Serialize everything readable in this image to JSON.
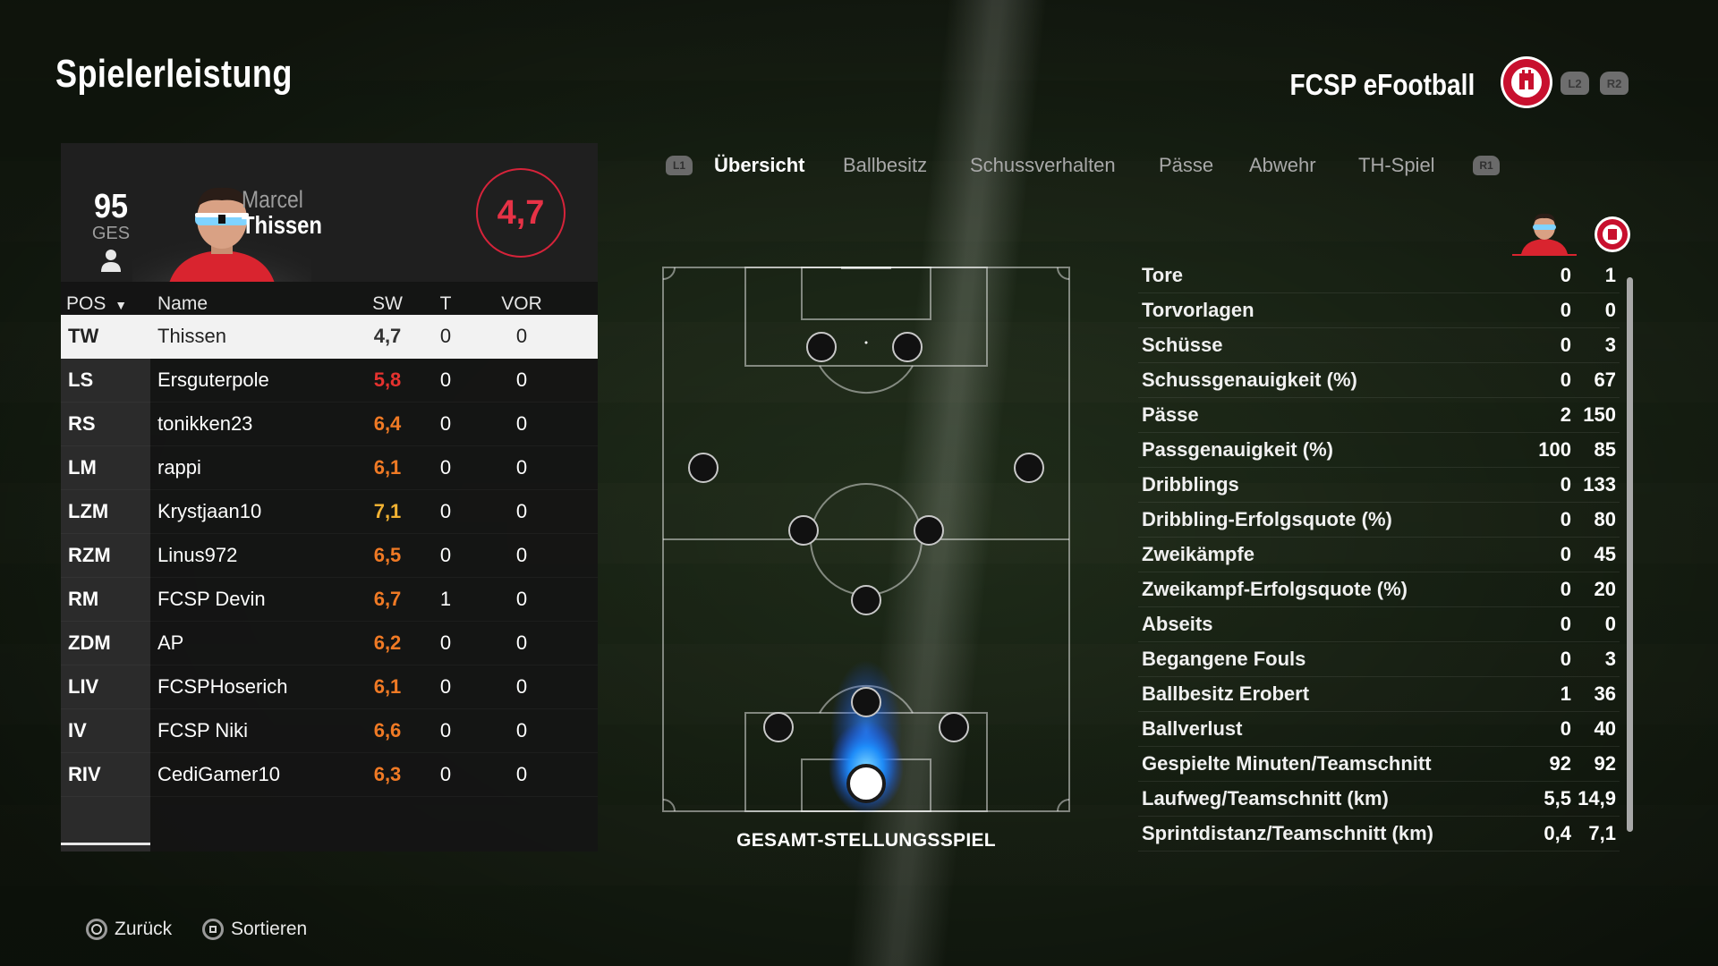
{
  "header": {
    "title": "Spielerleistung",
    "team_name": "FCSP eFootball",
    "left_trigger": "L2",
    "right_trigger": "R2"
  },
  "player_card": {
    "overall_value": "95",
    "overall_label": "GES",
    "first_name": "Marcel",
    "last_name": "Thissen",
    "match_rating": "4,7"
  },
  "table": {
    "headers": {
      "pos": "POS",
      "name": "Name",
      "sw": "SW",
      "t": "T",
      "vor": "VOR"
    },
    "rows": [
      {
        "pos": "TW",
        "name": "Thissen",
        "sw": "4,7",
        "t": "0",
        "vor": "0",
        "sw_color": "#333333"
      },
      {
        "pos": "LS",
        "name": "Ersguterpole",
        "sw": "5,8",
        "t": "0",
        "vor": "0",
        "sw_color": "#e5322f"
      },
      {
        "pos": "RS",
        "name": "tonikken23",
        "sw": "6,4",
        "t": "0",
        "vor": "0",
        "sw_color": "#f07a25"
      },
      {
        "pos": "LM",
        "name": "rappi",
        "sw": "6,1",
        "t": "0",
        "vor": "0",
        "sw_color": "#f07a25"
      },
      {
        "pos": "LZM",
        "name": "Krystjaan10",
        "sw": "7,1",
        "t": "0",
        "vor": "0",
        "sw_color": "#f2b233"
      },
      {
        "pos": "RZM",
        "name": "Linus972",
        "sw": "6,5",
        "t": "0",
        "vor": "0",
        "sw_color": "#f07a25"
      },
      {
        "pos": "RM",
        "name": "FCSP Devin",
        "sw": "6,7",
        "t": "1",
        "vor": "0",
        "sw_color": "#f07a25"
      },
      {
        "pos": "ZDM",
        "name": "AP",
        "sw": "6,2",
        "t": "0",
        "vor": "0",
        "sw_color": "#f07a25"
      },
      {
        "pos": "LIV",
        "name": "FCSPHoserich",
        "sw": "6,1",
        "t": "0",
        "vor": "0",
        "sw_color": "#f07a25"
      },
      {
        "pos": "IV",
        "name": "FCSP Niki",
        "sw": "6,6",
        "t": "0",
        "vor": "0",
        "sw_color": "#f07a25"
      },
      {
        "pos": "RIV",
        "name": "CediGamer10",
        "sw": "6,3",
        "t": "0",
        "vor": "0",
        "sw_color": "#f07a25"
      }
    ]
  },
  "tabs": {
    "left_button": "L1",
    "right_button": "R1",
    "items": [
      "Übersicht",
      "Ballbesitz",
      "Schussverhalten",
      "Pässe",
      "Abwehr",
      "TH-Spiel"
    ],
    "active_index": 0
  },
  "pitch": {
    "caption": "GESAMT-STELLUNGSSPIEL"
  },
  "stats": [
    {
      "label": "Tore",
      "player": "0",
      "team": "1"
    },
    {
      "label": "Torvorlagen",
      "player": "0",
      "team": "0"
    },
    {
      "label": "Schüsse",
      "player": "0",
      "team": "3"
    },
    {
      "label": "Schussgenauigkeit (%)",
      "player": "0",
      "team": "67"
    },
    {
      "label": "Pässe",
      "player": "2",
      "team": "150"
    },
    {
      "label": "Passgenauigkeit (%)",
      "player": "100",
      "team": "85"
    },
    {
      "label": "Dribblings",
      "player": "0",
      "team": "133"
    },
    {
      "label": "Dribbling-Erfolgsquote (%)",
      "player": "0",
      "team": "80"
    },
    {
      "label": "Zweikämpfe",
      "player": "0",
      "team": "45"
    },
    {
      "label": "Zweikampf-Erfolgsquote (%)",
      "player": "0",
      "team": "20"
    },
    {
      "label": "Abseits",
      "player": "0",
      "team": "0"
    },
    {
      "label": "Begangene Fouls",
      "player": "0",
      "team": "3"
    },
    {
      "label": "Ballbesitz Erobert",
      "player": "1",
      "team": "36"
    },
    {
      "label": "Ballverlust",
      "player": "0",
      "team": "40"
    },
    {
      "label": "Gespielte Minuten/Teamschnitt",
      "player": "92",
      "team": "92"
    },
    {
      "label": "Laufweg/Teamschnitt (km)",
      "player": "5,5",
      "team": "14,9"
    },
    {
      "label": "Sprintdistanz/Teamschnitt (km)",
      "player": "0,4",
      "team": "7,1"
    }
  ],
  "footer": {
    "back_label": "Zurück",
    "sort_label": "Sortieren"
  },
  "colors": {
    "accent_red": "#d6233a",
    "rating_orange": "#f07a25",
    "rating_yellow": "#f2b233",
    "heat_blue": "#1e90ff"
  }
}
